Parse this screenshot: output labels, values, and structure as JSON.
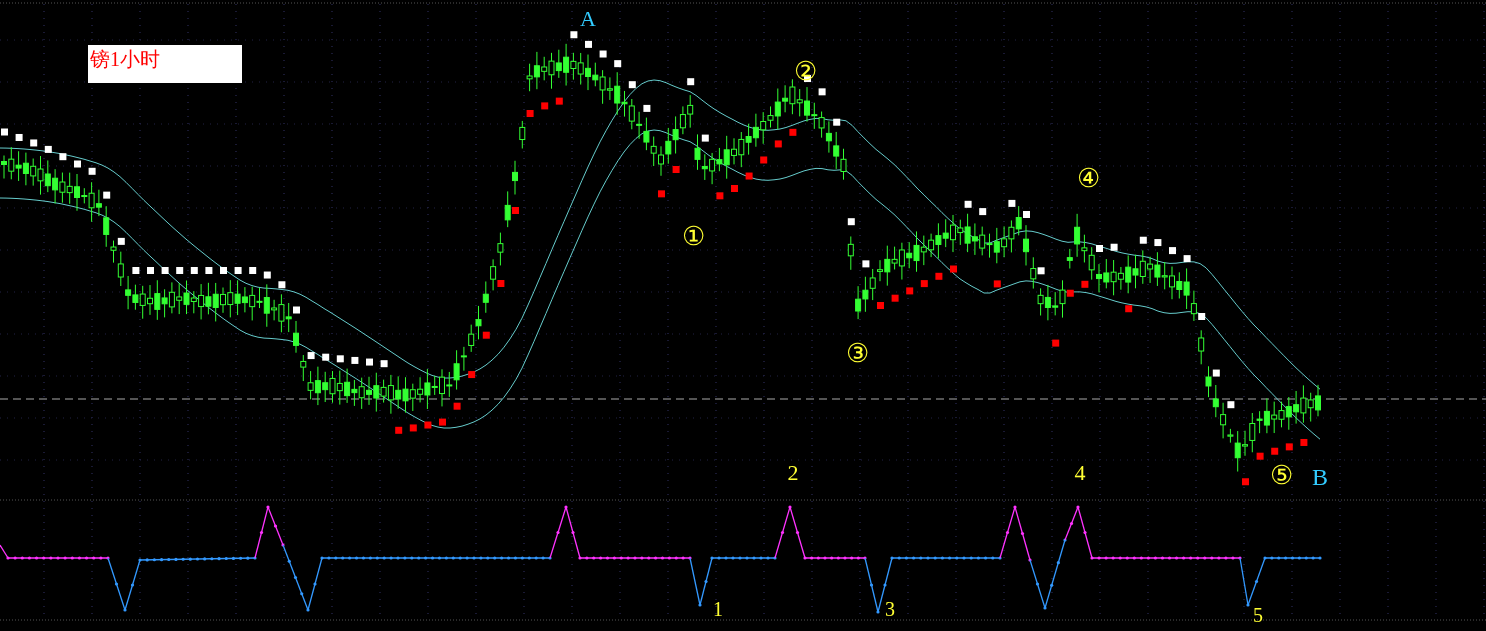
{
  "price_pane": {
    "label": "镑1小时",
    "markers": [
      {
        "text": "A",
        "color": "#33ccff"
      },
      {
        "text": "②",
        "color": "#ffff33"
      },
      {
        "text": "④",
        "color": "#ffff33"
      },
      {
        "text": "①",
        "color": "#ffff33"
      },
      {
        "text": "③",
        "color": "#ffff33"
      },
      {
        "text": "2",
        "color": "#ffff33"
      },
      {
        "text": "4",
        "color": "#ffff33"
      },
      {
        "text": "⑤",
        "color": "#ffff33"
      },
      {
        "text": "B",
        "color": "#33ccff"
      }
    ]
  },
  "indicator_pane": {
    "markers": [
      {
        "text": "1",
        "color": "#ffff33"
      },
      {
        "text": "3",
        "color": "#ffff33"
      },
      {
        "text": "5",
        "color": "#ffff33"
      }
    ]
  }
}
